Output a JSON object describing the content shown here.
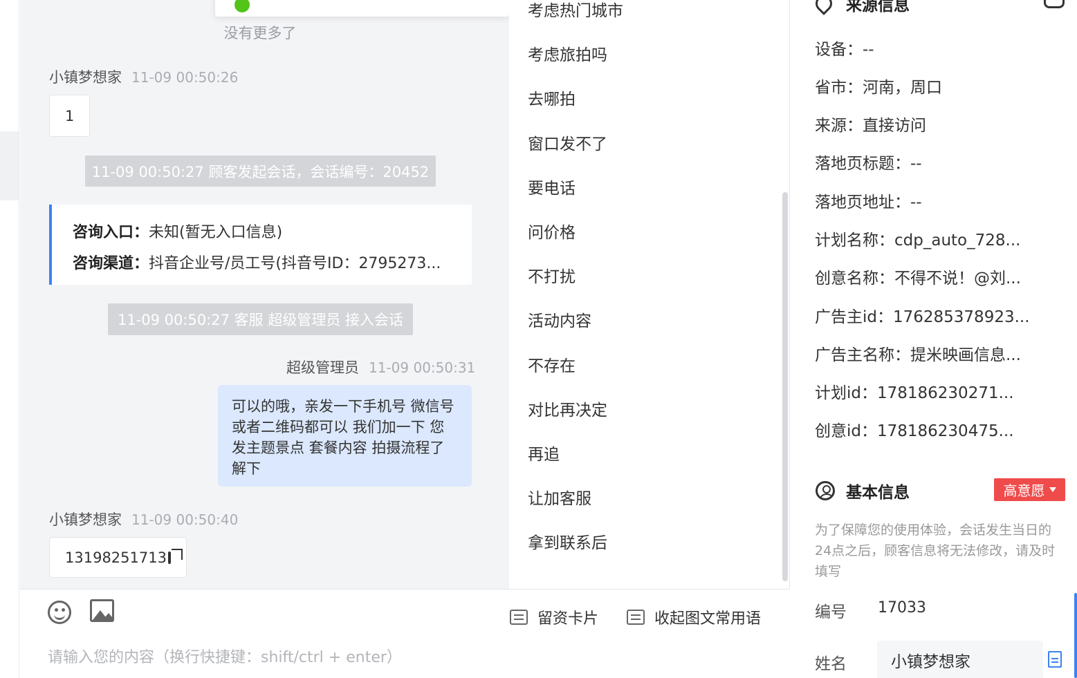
{
  "chat": {
    "no_more": "没有更多了",
    "messages": [
      {
        "sender": "小镇梦想家",
        "time": "11-09 00:50:26",
        "text": "1"
      },
      {
        "system": "11-09 00:50:27 顾客发起会话，会话编号：20452"
      },
      {
        "system": "11-09 00:50:27 客服 超级管理员 接入会话"
      },
      {
        "sender": "超级管理员",
        "time": "11-09 00:50:31",
        "text": "可以的哦，亲发一下手机号 微信号或者二维码都可以 我们加一下 您发主题景点 套餐内容 拍摄流程了解下"
      },
      {
        "sender": "小镇梦想家",
        "time": "11-09 00:50:40",
        "text": "13198251713"
      }
    ],
    "consult": {
      "entry_label": "咨询入口：",
      "entry_value": "未知(暂无入口信息)",
      "channel_label": "咨询渠道：",
      "channel_value": "抖音企业号/员工号(抖音号ID：2795273..."
    }
  },
  "phrases": [
    "考虑热门城市",
    "考虑旅拍吗",
    "去哪拍",
    "窗口发不了",
    "要电话",
    "问价格",
    "不打扰",
    "活动内容",
    "不存在",
    "对比再决定",
    "再追",
    "让加客服",
    "拿到联系后"
  ],
  "toolbar": {
    "emoji_icon": "emoji-icon",
    "image_icon": "image-icon",
    "card_label": "留资卡片",
    "collapse_label": "收起图文常用语",
    "input_placeholder": "请输入您的内容（换行快捷键：shift/ctrl + enter）"
  },
  "source": {
    "title": "来源信息",
    "rows": [
      "设备：--",
      "省市：河南，周口",
      "来源：直接访问",
      "落地页标题：--",
      "落地页地址：--",
      "计划名称：cdp_auto_728...",
      "创意名称：不得不说！@刘...",
      "广告主id：176285378923...",
      "广告主名称：提米映画信息...",
      "计划id：178186230271...",
      "创意id：178186230475..."
    ]
  },
  "basic": {
    "title": "基本信息",
    "intent_tag": "高意愿",
    "intent_color": "#f04b4b",
    "notice": "为了保障您的使用体验，会话发生当日的24点之后，顾客信息将无法修改，请及时填写",
    "id_label": "编号",
    "id_value": "17033",
    "name_label": "姓名",
    "name_value": "小镇梦想家"
  },
  "colors": {
    "accent": "#3b82f6",
    "bubble_blue": "#dbe8fd",
    "success": "#52c41a"
  }
}
